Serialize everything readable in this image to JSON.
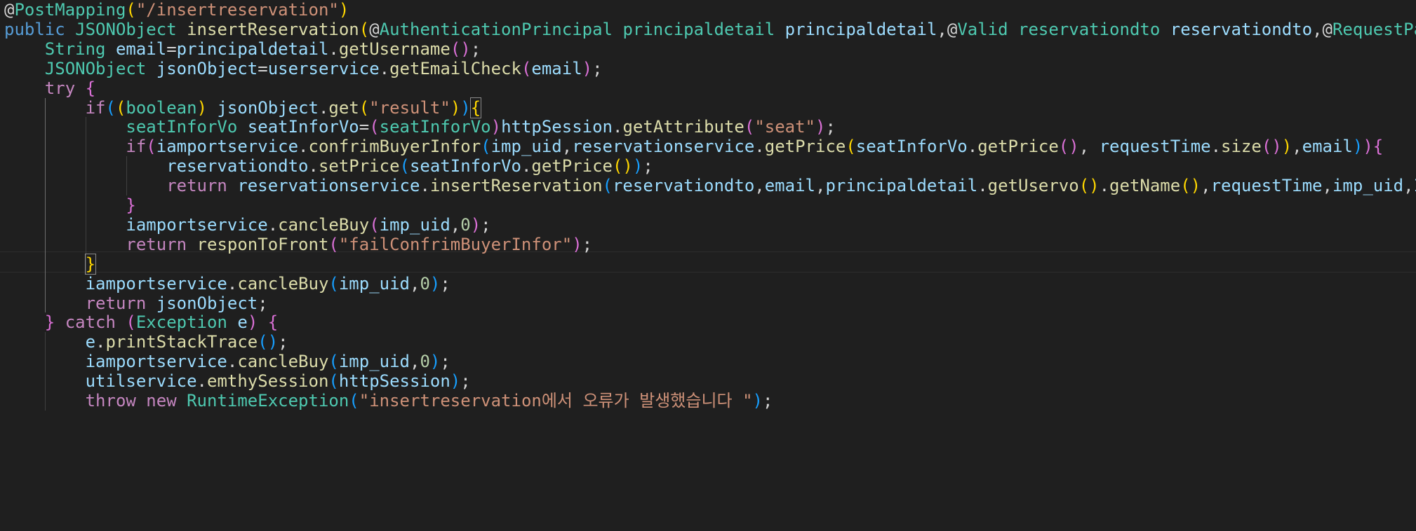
{
  "editor": {
    "theme": {
      "background": "#1f1f1f",
      "keyword": "#569cd6",
      "control": "#c586c0",
      "type": "#4ec9b0",
      "function": "#dcdcaa",
      "variable": "#9cdcfe",
      "string": "#ce9178",
      "number": "#b5cea8",
      "plain": "#d4d4d4",
      "bracket_gold": "#ffd700",
      "bracket_pink": "#da70d6",
      "bracket_blue": "#179fff"
    },
    "lines": [
      [
        [
          "@",
          "p"
        ],
        [
          "PostMapping",
          "t"
        ],
        [
          "(",
          "bg"
        ],
        [
          "\"/insertreservation\"",
          "s"
        ],
        [
          ")",
          "bg"
        ]
      ],
      [
        [
          "public",
          "k"
        ],
        [
          " ",
          "p"
        ],
        [
          "JSONObject",
          "t"
        ],
        [
          " ",
          "p"
        ],
        [
          "insertReservation",
          "f"
        ],
        [
          "(",
          "bg"
        ],
        [
          "@",
          "p"
        ],
        [
          "AuthenticationPrincipal",
          "t"
        ],
        [
          " ",
          "p"
        ],
        [
          "principaldetail",
          "t"
        ],
        [
          " ",
          "p"
        ],
        [
          "principaldetail",
          "v"
        ],
        [
          ",",
          "p"
        ],
        [
          "@",
          "p"
        ],
        [
          "Valid",
          "t"
        ],
        [
          " ",
          "p"
        ],
        [
          "reservationdto",
          "t"
        ],
        [
          " ",
          "p"
        ],
        [
          "reservationdto",
          "v"
        ],
        [
          ",",
          "p"
        ],
        [
          "@",
          "p"
        ],
        [
          "RequestPa",
          "t"
        ]
      ],
      [
        [
          "    ",
          "p"
        ],
        [
          "String",
          "t"
        ],
        [
          " ",
          "p"
        ],
        [
          "email",
          "v"
        ],
        [
          "=",
          "p"
        ],
        [
          "principaldetail",
          "v"
        ],
        [
          ".",
          "p"
        ],
        [
          "getUsername",
          "f"
        ],
        [
          "()",
          "bp"
        ],
        [
          ";",
          "p"
        ]
      ],
      [
        [
          "    ",
          "p"
        ],
        [
          "JSONObject",
          "t"
        ],
        [
          " ",
          "p"
        ],
        [
          "jsonObject",
          "v"
        ],
        [
          "=",
          "p"
        ],
        [
          "userservice",
          "v"
        ],
        [
          ".",
          "p"
        ],
        [
          "getEmailCheck",
          "f"
        ],
        [
          "(",
          "bp"
        ],
        [
          "email",
          "v"
        ],
        [
          ")",
          "bp"
        ],
        [
          ";",
          "p"
        ]
      ],
      [
        [
          "    ",
          "p"
        ],
        [
          "try",
          "c"
        ],
        [
          " ",
          "p"
        ],
        [
          "{",
          "bp"
        ]
      ],
      [
        [
          "        ",
          "p"
        ],
        [
          "if",
          "c"
        ],
        [
          "(",
          "bb"
        ],
        [
          "(",
          "bg"
        ],
        [
          "boolean",
          "t"
        ],
        [
          ")",
          "bg"
        ],
        [
          " ",
          "p"
        ],
        [
          "jsonObject",
          "v"
        ],
        [
          ".",
          "p"
        ],
        [
          "get",
          "f"
        ],
        [
          "(",
          "bg"
        ],
        [
          "\"result\"",
          "s"
        ],
        [
          ")",
          "bg"
        ],
        [
          ")",
          "bb"
        ],
        [
          "{",
          "bgx"
        ]
      ],
      [
        [
          "            ",
          "p"
        ],
        [
          "seatInforVo",
          "t"
        ],
        [
          " ",
          "p"
        ],
        [
          "seatInforVo",
          "v"
        ],
        [
          "=",
          "p"
        ],
        [
          "(",
          "bp"
        ],
        [
          "seatInforVo",
          "t"
        ],
        [
          ")",
          "bp"
        ],
        [
          "httpSession",
          "v"
        ],
        [
          ".",
          "p"
        ],
        [
          "getAttribute",
          "f"
        ],
        [
          "(",
          "bp"
        ],
        [
          "\"seat\"",
          "s"
        ],
        [
          ")",
          "bp"
        ],
        [
          ";",
          "p"
        ]
      ],
      [
        [
          "            ",
          "p"
        ],
        [
          "if",
          "c"
        ],
        [
          "(",
          "bp"
        ],
        [
          "iamportservice",
          "v"
        ],
        [
          ".",
          "p"
        ],
        [
          "confrimBuyerInfor",
          "f"
        ],
        [
          "(",
          "bb"
        ],
        [
          "imp_uid",
          "v"
        ],
        [
          ",",
          "p"
        ],
        [
          "reservationservice",
          "v"
        ],
        [
          ".",
          "p"
        ],
        [
          "getPrice",
          "f"
        ],
        [
          "(",
          "bg"
        ],
        [
          "seatInforVo",
          "v"
        ],
        [
          ".",
          "p"
        ],
        [
          "getPrice",
          "f"
        ],
        [
          "()",
          "bp"
        ],
        [
          ", ",
          "p"
        ],
        [
          "requestTime",
          "v"
        ],
        [
          ".",
          "p"
        ],
        [
          "size",
          "f"
        ],
        [
          "()",
          "bp"
        ],
        [
          ")",
          "bg"
        ],
        [
          ",",
          "p"
        ],
        [
          "email",
          "v"
        ],
        [
          ")",
          "bb"
        ],
        [
          ")",
          "bp"
        ],
        [
          "{",
          "bp"
        ]
      ],
      [
        [
          "                ",
          "p"
        ],
        [
          "reservationdto",
          "v"
        ],
        [
          ".",
          "p"
        ],
        [
          "setPrice",
          "f"
        ],
        [
          "(",
          "bb"
        ],
        [
          "seatInforVo",
          "v"
        ],
        [
          ".",
          "p"
        ],
        [
          "getPrice",
          "f"
        ],
        [
          "()",
          "bg"
        ],
        [
          ")",
          "bb"
        ],
        [
          ";",
          "p"
        ]
      ],
      [
        [
          "                ",
          "p"
        ],
        [
          "return",
          "c"
        ],
        [
          " ",
          "p"
        ],
        [
          "reservationservice",
          "v"
        ],
        [
          ".",
          "p"
        ],
        [
          "insertReservation",
          "f"
        ],
        [
          "(",
          "bb"
        ],
        [
          "reservationdto",
          "v"
        ],
        [
          ",",
          "p"
        ],
        [
          "email",
          "v"
        ],
        [
          ",",
          "p"
        ],
        [
          "principaldetail",
          "v"
        ],
        [
          ".",
          "p"
        ],
        [
          "getUservo",
          "f"
        ],
        [
          "()",
          "bg"
        ],
        [
          ".",
          "p"
        ],
        [
          "getName",
          "f"
        ],
        [
          "()",
          "bg"
        ],
        [
          ",",
          "p"
        ],
        [
          "requestTime",
          "v"
        ],
        [
          ",",
          "p"
        ],
        [
          "imp_uid",
          "v"
        ],
        [
          ",",
          "p"
        ],
        [
          "I",
          "v"
        ]
      ],
      [
        [
          "            ",
          "p"
        ],
        [
          "}",
          "bp"
        ]
      ],
      [
        [
          "            ",
          "p"
        ],
        [
          "iamportservice",
          "v"
        ],
        [
          ".",
          "p"
        ],
        [
          "cancleBuy",
          "f"
        ],
        [
          "(",
          "bp"
        ],
        [
          "imp_uid",
          "v"
        ],
        [
          ",",
          "p"
        ],
        [
          "0",
          "n"
        ],
        [
          ")",
          "bp"
        ],
        [
          ";",
          "p"
        ]
      ],
      [
        [
          "            ",
          "p"
        ],
        [
          "return",
          "c"
        ],
        [
          " ",
          "p"
        ],
        [
          "responToFront",
          "f"
        ],
        [
          "(",
          "bp"
        ],
        [
          "\"failConfrimBuyerInfor\"",
          "s"
        ],
        [
          ")",
          "bp"
        ],
        [
          ";",
          "p"
        ]
      ],
      [
        [
          "        ",
          "p"
        ],
        [
          "}",
          "bgx"
        ]
      ],
      [
        [
          "        ",
          "p"
        ],
        [
          "iamportservice",
          "v"
        ],
        [
          ".",
          "p"
        ],
        [
          "cancleBuy",
          "f"
        ],
        [
          "(",
          "bb"
        ],
        [
          "imp_uid",
          "v"
        ],
        [
          ",",
          "p"
        ],
        [
          "0",
          "n"
        ],
        [
          ")",
          "bb"
        ],
        [
          ";",
          "p"
        ]
      ],
      [
        [
          "        ",
          "p"
        ],
        [
          "return",
          "c"
        ],
        [
          " ",
          "p"
        ],
        [
          "jsonObject",
          "v"
        ],
        [
          ";",
          "p"
        ]
      ],
      [
        [
          "    ",
          "p"
        ],
        [
          "}",
          "bp"
        ],
        [
          " ",
          "p"
        ],
        [
          "catch",
          "c"
        ],
        [
          " ",
          "p"
        ],
        [
          "(",
          "bp"
        ],
        [
          "Exception",
          "t"
        ],
        [
          " ",
          "p"
        ],
        [
          "e",
          "v"
        ],
        [
          ")",
          "bp"
        ],
        [
          " ",
          "p"
        ],
        [
          "{",
          "bp"
        ]
      ],
      [
        [
          "        ",
          "p"
        ],
        [
          "e",
          "v"
        ],
        [
          ".",
          "p"
        ],
        [
          "printStackTrace",
          "f"
        ],
        [
          "()",
          "bb"
        ],
        [
          ";",
          "p"
        ]
      ],
      [
        [
          "        ",
          "p"
        ],
        [
          "iamportservice",
          "v"
        ],
        [
          ".",
          "p"
        ],
        [
          "cancleBuy",
          "f"
        ],
        [
          "(",
          "bb"
        ],
        [
          "imp_uid",
          "v"
        ],
        [
          ",",
          "p"
        ],
        [
          "0",
          "n"
        ],
        [
          ")",
          "bb"
        ],
        [
          ";",
          "p"
        ]
      ],
      [
        [
          "        ",
          "p"
        ],
        [
          "utilservice",
          "v"
        ],
        [
          ".",
          "p"
        ],
        [
          "emthySession",
          "f"
        ],
        [
          "(",
          "bb"
        ],
        [
          "httpSession",
          "v"
        ],
        [
          ")",
          "bb"
        ],
        [
          ";",
          "p"
        ]
      ],
      [
        [
          "        ",
          "p"
        ],
        [
          "throw",
          "c"
        ],
        [
          " ",
          "p"
        ],
        [
          "new",
          "c"
        ],
        [
          " ",
          "p"
        ],
        [
          "RuntimeException",
          "t"
        ],
        [
          "(",
          "bb"
        ],
        [
          "\"insertreservation에서 오류가 발생했습니다 \"",
          "s"
        ],
        [
          ")",
          "bb"
        ],
        [
          ";",
          "p"
        ]
      ]
    ]
  }
}
